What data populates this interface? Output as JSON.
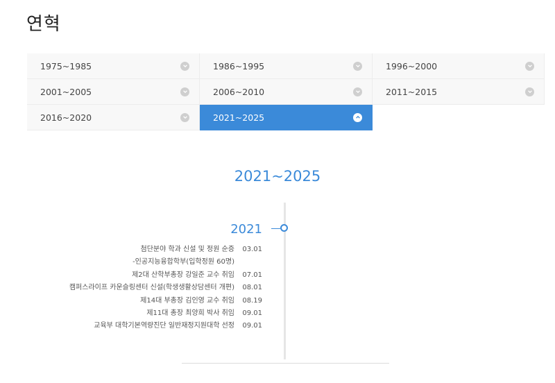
{
  "page": {
    "title": "연혁"
  },
  "periods": [
    {
      "label": "1975~1985",
      "active": false
    },
    {
      "label": "1986~1995",
      "active": false
    },
    {
      "label": "1996~2000",
      "active": false
    },
    {
      "label": "2001~2005",
      "active": false
    },
    {
      "label": "2006~2010",
      "active": false
    },
    {
      "label": "2011~2015",
      "active": false
    },
    {
      "label": "2016~2020",
      "active": false
    },
    {
      "label": "2021~2025",
      "active": true
    }
  ],
  "section": {
    "title": "2021~2025"
  },
  "timeline": {
    "year": "2021",
    "events": [
      {
        "text": "첨단분야 학과 신설 및 정원 순증",
        "date": "03.01"
      },
      {
        "text": "-인공지능융합학부(입학정원 60명)",
        "date": ""
      },
      {
        "text": "제2대 산학부총장 강일준 교수 취임",
        "date": "07.01"
      },
      {
        "text": "캠퍼스라이프 카운슬링센터 신설(학생생활상담센터 개편)",
        "date": "08.01"
      },
      {
        "text": "제14대 부총장 김인영 교수 취임",
        "date": "08.19"
      },
      {
        "text": "제11대 총장 최양희 박사 취임",
        "date": "09.01"
      },
      {
        "text": "교육부 대학기본역량진단 일반재정지원대학 선정",
        "date": "09.01"
      }
    ]
  },
  "colors": {
    "accent": "#3b8ad9",
    "cell_bg": "#f8f8f8",
    "chevron_inactive": "#cfcfcf"
  },
  "icons": {
    "collapsed": "chevron-down-icon",
    "expanded": "chevron-up-icon"
  }
}
